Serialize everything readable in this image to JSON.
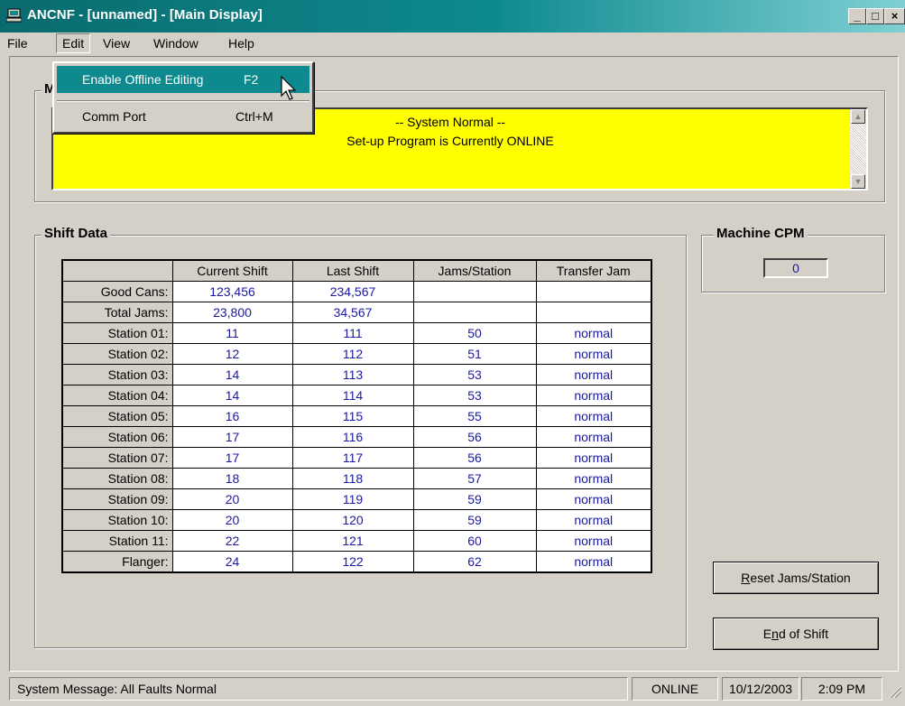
{
  "window": {
    "title": "ANCNF - [unnamed] - [Main Display]",
    "buttons": {
      "minimize": "_",
      "maximize": "□",
      "close": "×"
    }
  },
  "menubar": [
    "File",
    "Edit",
    "View",
    "Window",
    "Help"
  ],
  "edit_menu": {
    "items": [
      {
        "label": "Enable Offline Editing",
        "shortcut": "F2",
        "highlighted": true
      },
      {
        "label": "Comm Port",
        "shortcut": "Ctrl+M",
        "highlighted": false
      }
    ]
  },
  "message_group": {
    "visible_label_fragment": "M",
    "line1": "-- System Normal --",
    "line2": "Set-up Program is Currently ONLINE",
    "background": "#ffff00"
  },
  "shift_data": {
    "label": "Shift Data",
    "columns": [
      "",
      "Current Shift",
      "Last Shift",
      "Jams/Station",
      "Transfer Jam"
    ],
    "rows": [
      [
        "Good Cans:",
        "123,456",
        "234,567",
        "",
        ""
      ],
      [
        "Total Jams:",
        "23,800",
        "34,567",
        "",
        ""
      ],
      [
        "Station 01:",
        "11",
        "111",
        "50",
        "normal"
      ],
      [
        "Station 02:",
        "12",
        "112",
        "51",
        "normal"
      ],
      [
        "Station 03:",
        "14",
        "113",
        "53",
        "normal"
      ],
      [
        "Station 04:",
        "14",
        "114",
        "53",
        "normal"
      ],
      [
        "Station 05:",
        "16",
        "115",
        "55",
        "normal"
      ],
      [
        "Station 06:",
        "17",
        "116",
        "56",
        "normal"
      ],
      [
        "Station 07:",
        "17",
        "117",
        "56",
        "normal"
      ],
      [
        "Station 08:",
        "18",
        "118",
        "57",
        "normal"
      ],
      [
        "Station 09:",
        "20",
        "119",
        "59",
        "normal"
      ],
      [
        "Station 10:",
        "20",
        "120",
        "59",
        "normal"
      ],
      [
        "Station 11:",
        "22",
        "121",
        "60",
        "normal"
      ],
      [
        "Flanger:",
        "24",
        "122",
        "62",
        "normal"
      ]
    ],
    "value_color": "#1a1aa0"
  },
  "machine_cpm": {
    "label": "Machine CPM",
    "value": "0"
  },
  "buttons": {
    "reset": {
      "mnemonic": "R",
      "rest": "eset Jams/Station"
    },
    "end_shift": {
      "pre": "E",
      "mnemonic": "n",
      "rest": "d of Shift"
    }
  },
  "statusbar": {
    "message": "System Message:  All Faults Normal",
    "connection": "ONLINE",
    "date": "10/12/2003",
    "time": "2:09 PM"
  },
  "colors": {
    "titlebar": "#0e8a8f",
    "face": "#d4d0c8",
    "highlight": "#0e8a8f"
  },
  "icons": [
    "computer-app-icon",
    "mouse-pointer-icon",
    "scroll-up-arrow-icon",
    "scroll-down-arrow-icon",
    "size-grip-icon"
  ]
}
